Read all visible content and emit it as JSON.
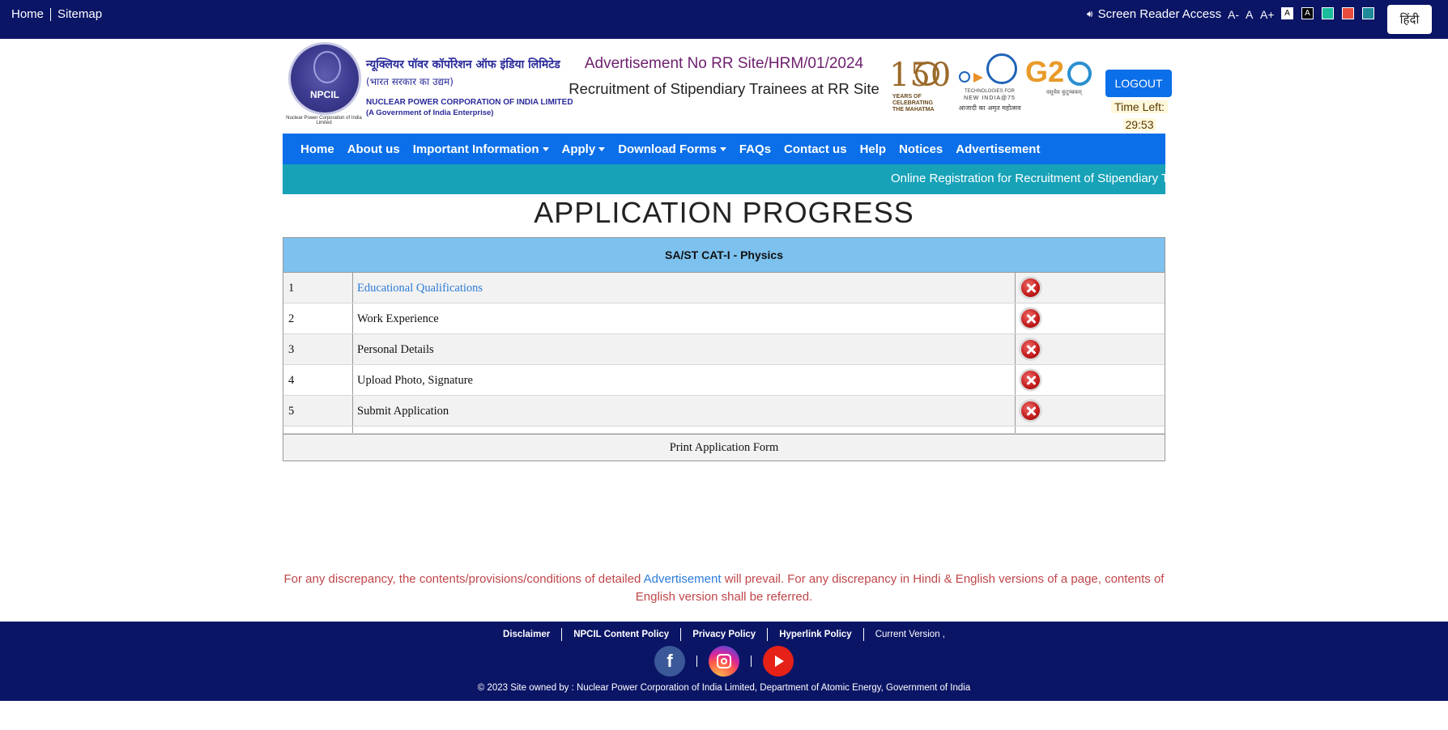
{
  "topbar": {
    "home": "Home",
    "sitemap": "Sitemap",
    "screen_reader": "Screen Reader Access",
    "font_small": "A-",
    "font_normal": "A",
    "font_large": "A+",
    "theme_white_label": "A",
    "theme_black_label": "A",
    "theme_colors": [
      "#ffffff",
      "#000000",
      "#1abc9c",
      "#e74c3c",
      "#1f8a9a"
    ],
    "language_button": "हिंदी"
  },
  "header": {
    "logo_text": "NPCIL",
    "logo_caption": "Nuclear Power Corporation of India Limited",
    "org_name_hindi": "न्यूक्लियर पॉवर कॉर्पोरेशन ऑफ इंडिया लिमिटेड",
    "org_sub_hindi": "(भारत सरकार का उद्यम)",
    "org_name_en": "NUCLEAR POWER CORPORATION OF INDIA LIMITED",
    "org_sub_en": "(A Government of India Enterprise)",
    "advertisement_no": "Advertisement No RR Site/HRM/01/2024",
    "recruitment_title": "Recruitment of Stipendiary Trainees at RR Site",
    "logo150_number": "150",
    "logo150_caption": "YEARS OF CELEBRATING THE MAHATMA",
    "tech_caption_1": "TECHNOLOGIES FOR",
    "tech_caption_2": "NEW INDIA@75",
    "tech_caption_3": "आजादी का अमृत महोत्सव",
    "g20_text": "G2",
    "g20_caption": "वसुधैव कुटुम्बकम्",
    "logout": "LOGOUT",
    "time_left_label": "Time Left:",
    "time_left_value": "29:53"
  },
  "nav": {
    "items": [
      {
        "label": "Home",
        "dropdown": false
      },
      {
        "label": "About us",
        "dropdown": false
      },
      {
        "label": "Important Information",
        "dropdown": true
      },
      {
        "label": "Apply",
        "dropdown": true
      },
      {
        "label": "Download Forms",
        "dropdown": true
      },
      {
        "label": "FAQs",
        "dropdown": false
      },
      {
        "label": "Contact us",
        "dropdown": false
      },
      {
        "label": "Help",
        "dropdown": false
      },
      {
        "label": "Notices",
        "dropdown": false
      },
      {
        "label": "Advertisement",
        "dropdown": false
      }
    ]
  },
  "marquee": {
    "text": "Online Registration for Recruitment of Stipendiary Trainees at RR Site"
  },
  "main": {
    "title": "APPLICATION PROGRESS",
    "table_header": "SA/ST CAT-I - Physics",
    "steps": [
      {
        "num": "1",
        "label": "Educational Qualifications",
        "link": true,
        "status": "incomplete"
      },
      {
        "num": "2",
        "label": "Work Experience",
        "link": false,
        "status": "incomplete"
      },
      {
        "num": "3",
        "label": "Personal Details",
        "link": false,
        "status": "incomplete"
      },
      {
        "num": "4",
        "label": "Upload Photo, Signature",
        "link": false,
        "status": "incomplete"
      },
      {
        "num": "5",
        "label": "Submit Application",
        "link": false,
        "status": "incomplete"
      }
    ],
    "print_label": "Print Application Form"
  },
  "disclaimer": {
    "part1": "For any discrepancy, the contents/provisions/conditions of detailed ",
    "link": "Advertisement",
    "part2": " will prevail. For any discrepancy in Hindi & English versions of a page, contents of English version shall be referred."
  },
  "footer": {
    "links": [
      "Disclaimer",
      "NPCIL Content Policy",
      "Privacy Policy",
      "Hyperlink Policy"
    ],
    "version": "Current Version ,",
    "facebook_label": "f",
    "copyright": "© 2023 Site owned by : Nuclear Power Corporation of India Limited, Department of Atomic Energy, Government of India"
  }
}
